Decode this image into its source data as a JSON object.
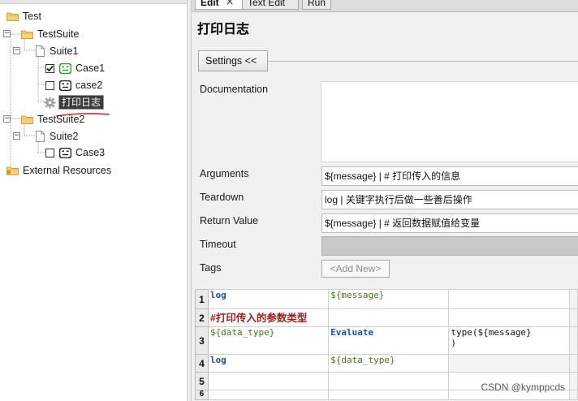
{
  "tree": {
    "root": "Test",
    "suite1": "TestSuite",
    "suite1_child": "Suite1",
    "test1": "Case1",
    "test2": "case2",
    "keyword": "打印日志",
    "suite2": "TestSuite2",
    "suite2_child": "Suite2",
    "test3": "Case3",
    "external": "External Resources",
    "test1_checked": true,
    "test2_checked": false,
    "test3_checked": false
  },
  "tabs": [
    {
      "label": "Edit",
      "active": true
    },
    {
      "label": "Text Edit",
      "active": false
    },
    {
      "label": "Run",
      "active": false
    }
  ],
  "tab_close_glyph": "×",
  "editor": {
    "title": "打印日志",
    "settings_button": "Settings <<",
    "fields": {
      "documentation_label": "Documentation",
      "arguments_label": "Arguments",
      "arguments_value": "${message} | # 打印传入的信息",
      "teardown_label": "Teardown",
      "teardown_value": "log | 关键字执行后做一些善后操作",
      "return_label": "Return Value",
      "return_value": "${message} | # 返回数据赋值给变量",
      "timeout_label": "Timeout",
      "tags_label": "Tags",
      "add_new": "<Add New>"
    },
    "grid": {
      "row_numbers": [
        "1",
        "2",
        "3",
        "4",
        "5",
        "6"
      ],
      "r1c1": "log",
      "r1c2": "${message}",
      "r2c1": "#打印传入的参数类型",
      "r3c1": "${data_type}",
      "r3c2": "Evaluate",
      "r3c3": "type(${message}\n)",
      "r4c1": "log",
      "r4c2": "${data_type}"
    }
  },
  "watermark": "CSDN @kymppcds",
  "colors": {
    "keyword": "#1f4fb0",
    "variable": "#3a7a19",
    "comment": "#9c1c1c",
    "annotation_red": "#e0242a",
    "check_green": "#22a02a"
  },
  "icons": [
    "folder-icon",
    "page-icon",
    "robot-icon",
    "gear-icon",
    "checkbox-checked",
    "checkbox-empty",
    "close-icon"
  ]
}
